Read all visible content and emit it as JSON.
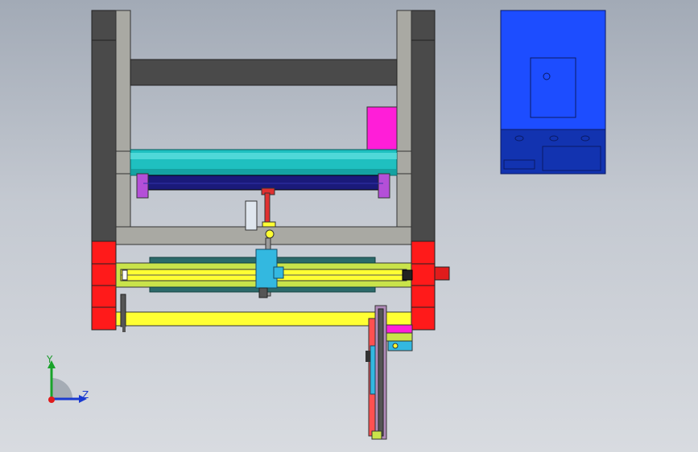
{
  "viewport": {
    "background": "#b8bec8"
  },
  "triad": {
    "y_label": "Y",
    "z_label": "Z",
    "y_color": "#19a32a",
    "z_color": "#1a3ad0",
    "origin_color": "#e01c1c"
  },
  "colors": {
    "frame_dark": "#4a4a4a",
    "frame_light": "#a9a9a3",
    "roller": "#1fc0c0",
    "magenta": "#ff1ed8",
    "rail_yellow": "#ffff33",
    "rail_green": "#c9e34a",
    "red_block": "#ff1a1a",
    "cabinet_blue": "#1d4dff",
    "cabinet_dark": "#1233b0"
  },
  "icons": [
    "coordinate-triad-icon"
  ]
}
